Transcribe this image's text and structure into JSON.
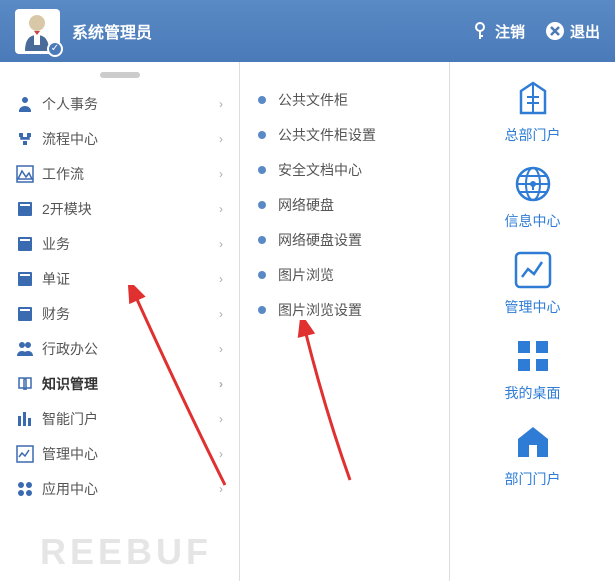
{
  "header": {
    "username": "系统管理员",
    "logout_label": "注销",
    "exit_label": "退出"
  },
  "sidebar": {
    "items": [
      {
        "label": "个人事务",
        "icon": "person"
      },
      {
        "label": "流程中心",
        "icon": "flow"
      },
      {
        "label": "工作流",
        "icon": "workflow"
      },
      {
        "label": "2开模块",
        "icon": "module"
      },
      {
        "label": "业务",
        "icon": "business"
      },
      {
        "label": "单证",
        "icon": "doc"
      },
      {
        "label": "财务",
        "icon": "finance"
      },
      {
        "label": "行政办公",
        "icon": "admin"
      },
      {
        "label": "知识管理",
        "icon": "knowledge"
      },
      {
        "label": "智能门户",
        "icon": "portal"
      },
      {
        "label": "管理中心",
        "icon": "manage"
      },
      {
        "label": "应用中心",
        "icon": "app"
      }
    ]
  },
  "submenu": {
    "items": [
      {
        "label": "公共文件柜"
      },
      {
        "label": "公共文件柜设置"
      },
      {
        "label": "安全文档中心"
      },
      {
        "label": "网络硬盘"
      },
      {
        "label": "网络硬盘设置"
      },
      {
        "label": "图片浏览"
      },
      {
        "label": "图片浏览设置"
      }
    ]
  },
  "rightbar": {
    "items": [
      {
        "label": "总部门户",
        "icon": "building"
      },
      {
        "label": "信息中心",
        "icon": "globe"
      },
      {
        "label": "管理中心",
        "icon": "chart"
      },
      {
        "label": "我的桌面",
        "icon": "grid"
      },
      {
        "label": "部门门户",
        "icon": "house"
      }
    ]
  },
  "watermark": "REEBUF"
}
